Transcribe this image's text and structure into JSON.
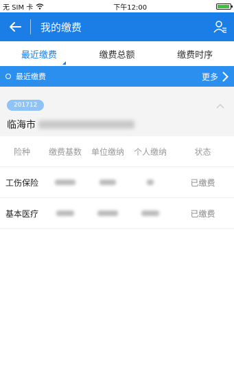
{
  "status_bar": {
    "carrier": "无 SIM 卡",
    "time": "下午12:00"
  },
  "app_bar": {
    "title": "我的缴费"
  },
  "tabs": [
    {
      "label": "最近缴费",
      "active": true
    },
    {
      "label": "缴费总额",
      "active": false
    },
    {
      "label": "缴费时序",
      "active": false
    }
  ],
  "section": {
    "title": "最近缴费",
    "more_label": "更多"
  },
  "record": {
    "period": "201712",
    "city": "临海市"
  },
  "table": {
    "headers": [
      "险种",
      "缴费基数",
      "单位缴纳",
      "个人缴纳",
      "状态"
    ],
    "rows": [
      {
        "type": "工伤保险",
        "status": "已缴费"
      },
      {
        "type": "基本医疗",
        "status": "已缴费"
      }
    ]
  },
  "colors": {
    "primary": "#1a7ee6",
    "section_bar": "#2b8ff0",
    "badge": "#8fc3f5"
  },
  "icons": [
    "back-arrow-icon",
    "user-list-icon",
    "wifi-icon",
    "battery-icon",
    "chevron-right-icon",
    "chevron-up-icon"
  ]
}
